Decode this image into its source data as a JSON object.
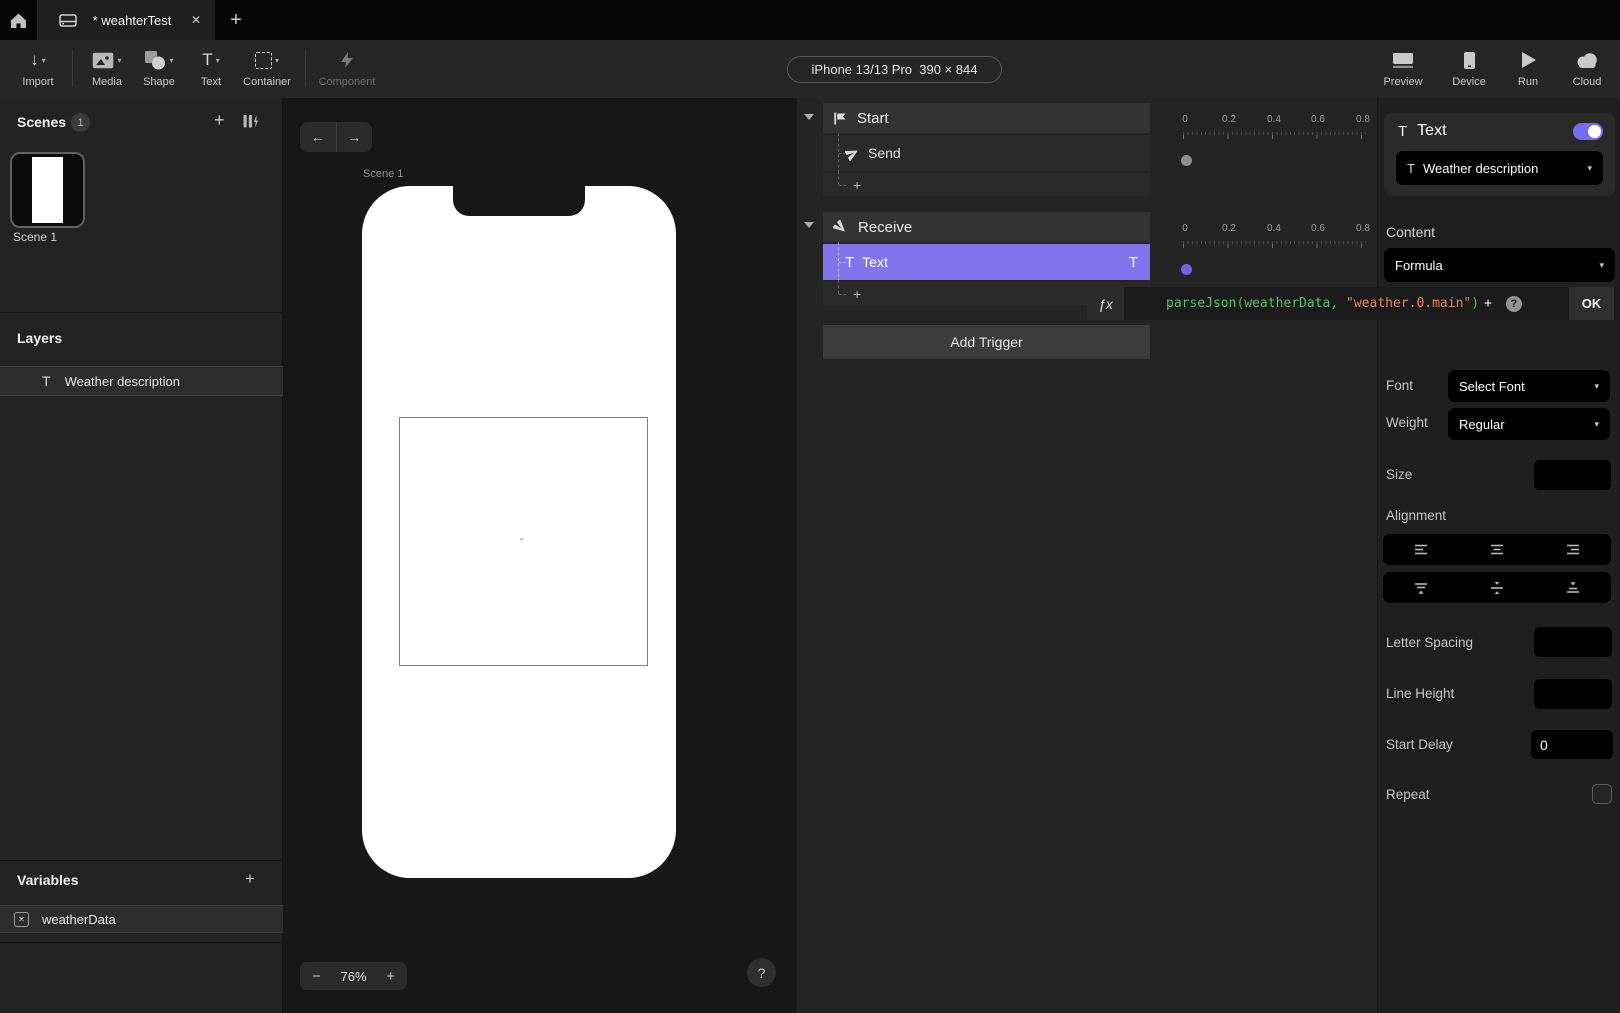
{
  "tabbar": {
    "tab_title": "* weahterTest"
  },
  "icons": {
    "caret": "▾",
    "plus": "+",
    "close": "✕",
    "minus": "−",
    "back": "←",
    "forward": "→",
    "question": "?",
    "t": "T",
    "fx": "ƒx",
    "import_arrow": "↓"
  },
  "toolbar": {
    "import": "Import",
    "media": "Media",
    "shape": "Shape",
    "text": "Text",
    "container": "Container",
    "component": "Component",
    "device_selector": "iPhone 13/13 Pro  390 × 844",
    "preview": "Preview",
    "device": "Device",
    "run": "Run",
    "cloud": "Cloud"
  },
  "scenes": {
    "title": "Scenes",
    "count": "1",
    "scene1": "Scene 1"
  },
  "layers": {
    "title": "Layers",
    "layer1": "Weather description"
  },
  "variables": {
    "title": "Variables",
    "var1": "weatherData"
  },
  "canvas": {
    "scene_label": "Scene 1",
    "text_placeholder": "-",
    "zoom": "76%"
  },
  "triggers": {
    "start": "Start",
    "send": "Send",
    "receive": "Receive",
    "text_response": "Text",
    "add_trigger": "Add Trigger",
    "formula_fn": "parseJson(weatherData, ",
    "formula_str": "\"weather.0.main\"",
    "formula_close": ")",
    "formula_plus": "+",
    "ok": "OK"
  },
  "timeline": {
    "t0": "0",
    "t1": "0.2",
    "t2": "0.4",
    "t3": "0.6",
    "t4": "0.8"
  },
  "props": {
    "title": "Text",
    "target": "Weather description",
    "content_label": "Content",
    "content_value": "Formula",
    "font_label": "Font",
    "font_value": "Select Font",
    "weight_label": "Weight",
    "weight_value": "Regular",
    "size_label": "Size",
    "alignment_label": "Alignment",
    "letter_spacing_label": "Letter Spacing",
    "line_height_label": "Line Height",
    "start_delay_label": "Start Delay",
    "start_delay_value": "0",
    "repeat_label": "Repeat"
  },
  "colors": {
    "accent": "#8374ee",
    "toggle": "#7a6cf0",
    "formula_green": "#5dbe6c",
    "formula_orange": "#e2855c"
  }
}
